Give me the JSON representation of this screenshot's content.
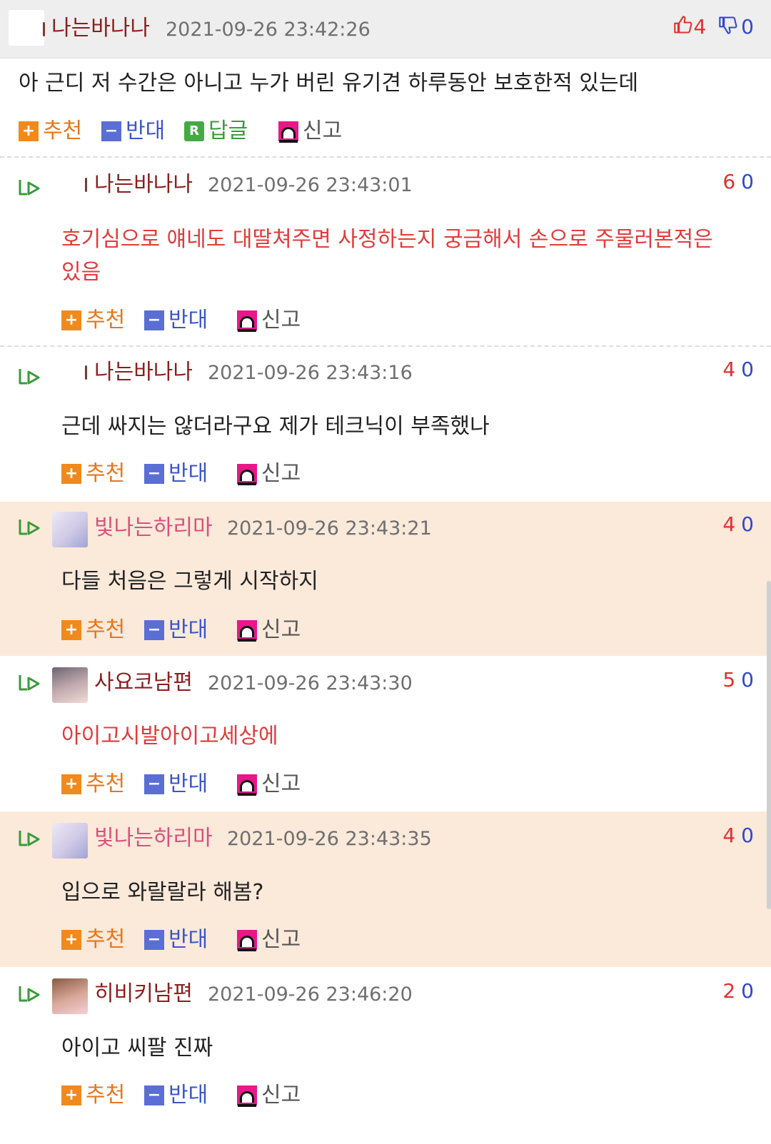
{
  "comments": [
    {
      "nickname": "나는바나나",
      "timestamp": "2021-09-26 23:42:26",
      "upvotes": "4",
      "downvotes": "0",
      "text": "아 근디 저 수간은 아니고 누가 버린 유기견 하루동안 보호한적 있는데",
      "actions": {
        "recommend": "추천",
        "oppose": "반대",
        "reply": "답글",
        "report": "신고"
      }
    },
    {
      "nickname": "나는바나나",
      "timestamp": "2021-09-26 23:43:01",
      "upvotes": "6",
      "downvotes": "0",
      "text": "호기심으로 얘네도 대딸쳐주면 사정하는지 궁금해서 손으로 주물러본적은 있음",
      "actions": {
        "recommend": "추천",
        "oppose": "반대",
        "report": "신고"
      }
    },
    {
      "nickname": "나는바나나",
      "timestamp": "2021-09-26 23:43:16",
      "upvotes": "4",
      "downvotes": "0",
      "text": "근데 싸지는 않더라구요 제가 테크닉이 부족했나",
      "actions": {
        "recommend": "추천",
        "oppose": "반대",
        "report": "신고"
      }
    },
    {
      "nickname": "빛나는하리마",
      "timestamp": "2021-09-26 23:43:21",
      "upvotes": "4",
      "downvotes": "0",
      "text": "다들 처음은 그렇게 시작하지",
      "actions": {
        "recommend": "추천",
        "oppose": "반대",
        "report": "신고"
      }
    },
    {
      "nickname": "사요코남편",
      "timestamp": "2021-09-26 23:43:30",
      "upvotes": "5",
      "downvotes": "0",
      "text": "아이고시발아이고세상에",
      "actions": {
        "recommend": "추천",
        "oppose": "반대",
        "report": "신고"
      }
    },
    {
      "nickname": "빛나는하리마",
      "timestamp": "2021-09-26 23:43:35",
      "upvotes": "4",
      "downvotes": "0",
      "text": "입으로 와랄랄라 해봄?",
      "actions": {
        "recommend": "추천",
        "oppose": "반대",
        "report": "신고"
      }
    },
    {
      "nickname": "히비키남편",
      "timestamp": "2021-09-26 23:46:20",
      "upvotes": "2",
      "downvotes": "0",
      "text": "아이고 씨팔 진짜",
      "actions": {
        "recommend": "추천",
        "oppose": "반대",
        "report": "신고"
      }
    }
  ],
  "colors": {
    "nickname": "#8b1f1f",
    "nickname_pink": "#d9517a",
    "highlight_text": "#e23b3b",
    "upvote": "#e03030",
    "downvote": "#3148c9",
    "highlight_bg": "#fbe9da",
    "top_bg": "#eeeeee"
  },
  "icons": {
    "reply_indicator": "reply-arrow-icon",
    "upvote": "thumbs-up-icon",
    "downvote": "thumbs-down-icon",
    "recommend": "plus-icon",
    "oppose": "minus-icon",
    "reply": "reply-r-icon",
    "report": "siren-icon"
  }
}
